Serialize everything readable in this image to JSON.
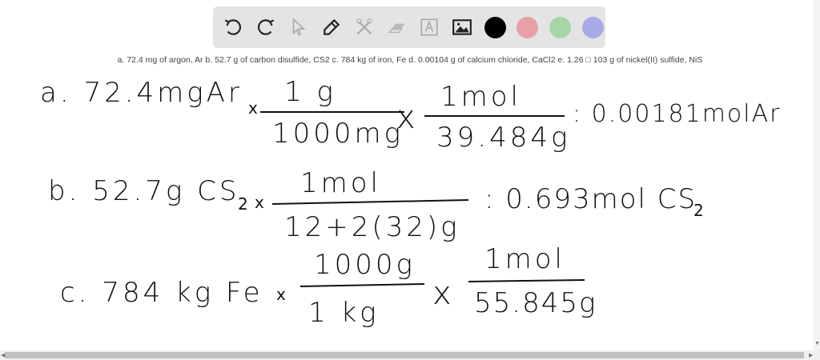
{
  "toolbar": {
    "tools": [
      "undo",
      "redo",
      "select",
      "pen",
      "tools",
      "eraser",
      "text",
      "image"
    ],
    "colors": {
      "black": "#000000",
      "red": "#e8a0a6",
      "green": "#a8d5a8",
      "blue": "#a9a9e8"
    }
  },
  "problem_text": "a. 72.4 mg of argon, Ar b. 52.7 g of carbon disulfide, CS2 c. 784 kg of iron, Fe d. 0.00104 g of calcium chloride, CaCl2 e. 1.26 □ 103 g of nickel(II) sulfide, NiS",
  "work": {
    "a": {
      "start": "a. 72.4mgAr",
      "x1": "x",
      "num1": "1 g",
      "den1": "1000mg",
      "x2": "x",
      "num2": "1mol",
      "den2": "39.484g",
      "result": ": 0.00181molAr"
    },
    "b": {
      "start": "b. 52.7g CS",
      "sub": "2",
      "x1": "x",
      "num1": "1mol",
      "den1": "12+2(32)g",
      "result": ": 0.693mol CS",
      "result_sub": "2"
    },
    "c": {
      "start": "c. 784 kg Fe",
      "x1": "x",
      "num1": "1000g",
      "den1": "1 kg",
      "x2": "x",
      "num2": "1mol",
      "den2": "55.845g"
    }
  }
}
